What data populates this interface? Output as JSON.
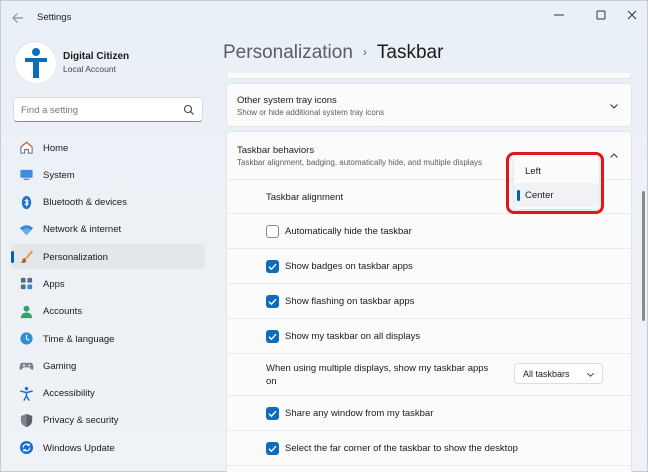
{
  "window": {
    "title": "Settings"
  },
  "profile": {
    "name": "Digital Citizen",
    "account_type": "Local Account"
  },
  "search": {
    "placeholder": "Find a setting"
  },
  "nav": {
    "items": [
      {
        "label": "Home",
        "icon": "home-icon"
      },
      {
        "label": "System",
        "icon": "system-icon"
      },
      {
        "label": "Bluetooth & devices",
        "icon": "bluetooth-icon"
      },
      {
        "label": "Network & internet",
        "icon": "wifi-icon"
      },
      {
        "label": "Personalization",
        "icon": "brush-icon",
        "active": true
      },
      {
        "label": "Apps",
        "icon": "apps-icon"
      },
      {
        "label": "Accounts",
        "icon": "accounts-icon"
      },
      {
        "label": "Time & language",
        "icon": "time-language-icon"
      },
      {
        "label": "Gaming",
        "icon": "gaming-icon"
      },
      {
        "label": "Accessibility",
        "icon": "accessibility-icon"
      },
      {
        "label": "Privacy & security",
        "icon": "shield-icon"
      },
      {
        "label": "Windows Update",
        "icon": "update-icon"
      }
    ]
  },
  "breadcrumb": {
    "parent": "Personalization",
    "separator": "›",
    "current": "Taskbar"
  },
  "tray": {
    "title": "Other system tray icons",
    "subtitle": "Show or hide additional system tray icons"
  },
  "behaviors": {
    "title": "Taskbar behaviors",
    "subtitle": "Taskbar alignment, badging, automatically hide, and multiple displays",
    "alignment_label": "Taskbar alignment",
    "alignment_options": [
      "Left",
      "Center"
    ],
    "alignment_selected": "Center",
    "auto_hide": {
      "label": "Automatically hide the taskbar",
      "checked": false
    },
    "badges": {
      "label": "Show badges on taskbar apps",
      "checked": true
    },
    "flashing": {
      "label": "Show flashing on taskbar apps",
      "checked": true
    },
    "all_displays": {
      "label": "Show my taskbar on all displays",
      "checked": true
    },
    "multi_display_label_line1": "When using multiple displays, show my taskbar apps",
    "multi_display_label_line2": "on",
    "multi_display_value": "All taskbars",
    "share_window": {
      "label": "Share any window from my taskbar",
      "checked": true
    },
    "far_corner": {
      "label": "Select the far corner of the taskbar to show the desktop",
      "checked": true
    }
  },
  "colors": {
    "accent": "#005fb8",
    "highlight": "#e0161c"
  }
}
